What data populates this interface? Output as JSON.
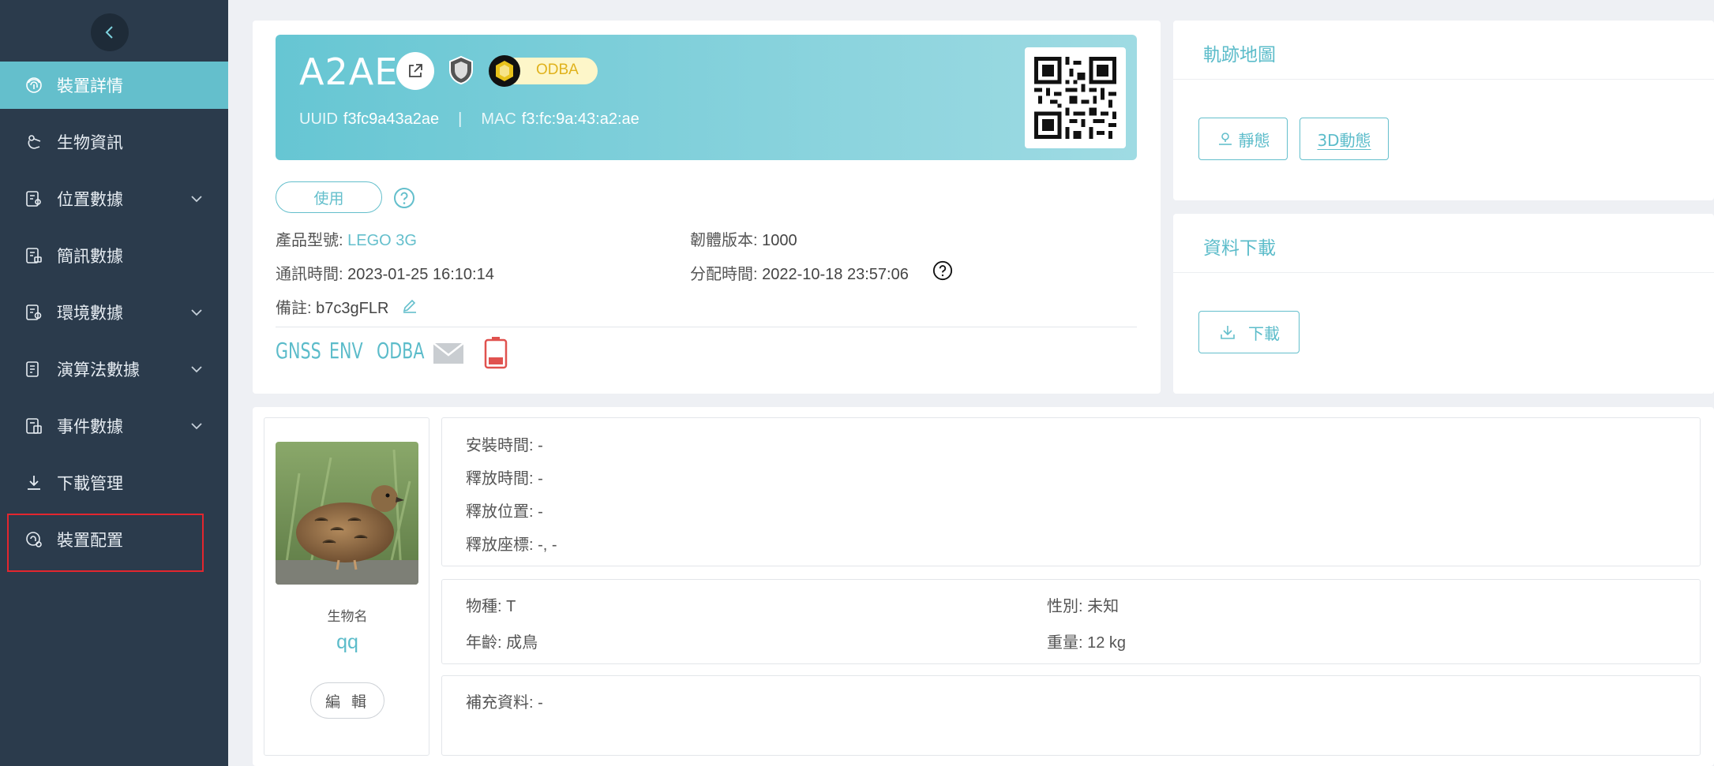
{
  "sidebar": {
    "items": [
      {
        "label": "裝置詳情",
        "icon": "fingerprint-icon",
        "active": true
      },
      {
        "label": "生物資訊",
        "icon": "bird-icon"
      },
      {
        "label": "位置數據",
        "icon": "location-data-icon",
        "expandable": true
      },
      {
        "label": "簡訊數據",
        "icon": "sms-data-icon"
      },
      {
        "label": "環境數據",
        "icon": "environment-data-icon",
        "expandable": true
      },
      {
        "label": "演算法數據",
        "icon": "algorithm-data-icon",
        "expandable": true
      },
      {
        "label": "事件數據",
        "icon": "event-data-icon",
        "expandable": true
      },
      {
        "label": "下載管理",
        "icon": "download-icon"
      },
      {
        "label": "裝置配置",
        "icon": "device-config-icon",
        "highlighted": true
      }
    ]
  },
  "device": {
    "name": "A2AE",
    "odba_badge": "ODBA",
    "uuid_label": "UUID",
    "uuid": "f3fc9a43a2ae",
    "mac_label": "MAC",
    "mac": "f3:fc:9a:43:a2:ae",
    "status": "使用",
    "model_label": "產品型號:",
    "model": "LEGO 3G",
    "firmware_label": "韌體版本:",
    "firmware": "1000",
    "comm_time_label": "通訊時間:",
    "comm_time": "2023-01-25 16:10:14",
    "assign_time_label": "分配時間:",
    "assign_time": "2022-10-18 23:57:06",
    "note_label": "備註:",
    "note": "b7c3gFLR",
    "sensors": [
      "GNSS",
      "ENV",
      "ODBA"
    ]
  },
  "map_card": {
    "title": "軌跡地圖",
    "static_btn": "靜態",
    "dynamic_btn": "3D動態"
  },
  "download_card": {
    "title": "資料下載",
    "download_btn": "下載"
  },
  "bio": {
    "name_label": "生物名",
    "name": "qq",
    "edit_btn": "編 輯",
    "install_time": "安裝時間: -",
    "release_time": "釋放時間: -",
    "release_place": "釋放位置: -",
    "release_coord": "釋放座標: -, -",
    "species": "物種: T",
    "sex": "性別: 未知",
    "age": "年齡: 成鳥",
    "weight": "重量: 12 kg",
    "extra": "補充資料: -"
  },
  "colors": {
    "sidebar_bg": "#2b3b4c",
    "accent": "#64bfcc",
    "highlight_border": "#e3262e",
    "battery_low": "#e0524f"
  }
}
